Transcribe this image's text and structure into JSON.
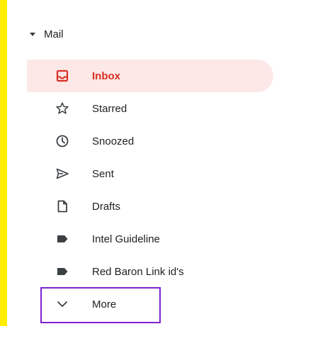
{
  "section": {
    "label": "Mail"
  },
  "nav": {
    "items": [
      {
        "label": "Inbox",
        "icon": "inbox-icon",
        "active": true
      },
      {
        "label": "Starred",
        "icon": "star-icon"
      },
      {
        "label": "Snoozed",
        "icon": "clock-icon"
      },
      {
        "label": "Sent",
        "icon": "send-icon"
      },
      {
        "label": "Drafts",
        "icon": "draft-icon"
      },
      {
        "label": "Intel Guideline",
        "icon": "label-icon"
      },
      {
        "label": "Red Baron Link id's",
        "icon": "label-icon"
      },
      {
        "label": "More",
        "icon": "chevron-down-icon"
      }
    ]
  },
  "colors": {
    "active_bg": "#fce8e6",
    "active_text": "#d93025",
    "highlight_border": "#7e22ce",
    "left_bar": "#ffee00"
  }
}
